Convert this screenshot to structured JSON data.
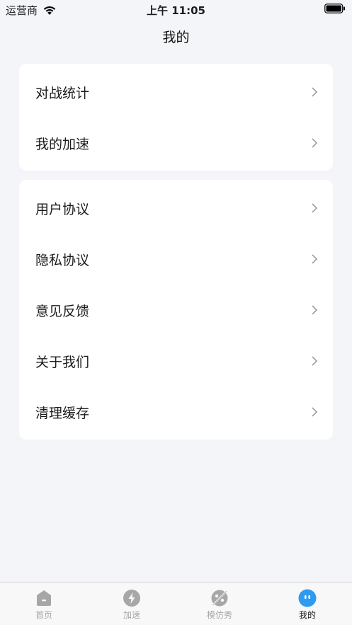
{
  "status_bar": {
    "carrier": "运营商",
    "time": "上午 11:05"
  },
  "nav": {
    "title": "我的"
  },
  "group1": [
    {
      "label": "对战统计",
      "icon": "chevron-right-icon"
    },
    {
      "label": "我的加速",
      "icon": "chevron-right-icon"
    }
  ],
  "group2": [
    {
      "label": "用户协议",
      "icon": "chevron-right-icon"
    },
    {
      "label": "隐私协议",
      "icon": "chevron-right-icon"
    },
    {
      "label": "意见反馈",
      "icon": "chevron-right-icon"
    },
    {
      "label": "关于我们",
      "icon": "chevron-right-icon"
    },
    {
      "label": "清理缓存",
      "icon": "chevron-right-icon"
    }
  ],
  "tabbar": {
    "tabs": [
      {
        "label": "首页",
        "icon": "home-icon",
        "active": false
      },
      {
        "label": "加速",
        "icon": "lightning-icon",
        "active": false
      },
      {
        "label": "模仿秀",
        "icon": "mask-icon",
        "active": false
      },
      {
        "label": "我的",
        "icon": "profile-face-icon",
        "active": true
      }
    ]
  },
  "colors": {
    "background": "#f4f5f9",
    "card": "#ffffff",
    "tab_inactive": "#a7a7a7",
    "tab_active_icon": "#2e9bf3",
    "chevron": "#8e8e93"
  }
}
